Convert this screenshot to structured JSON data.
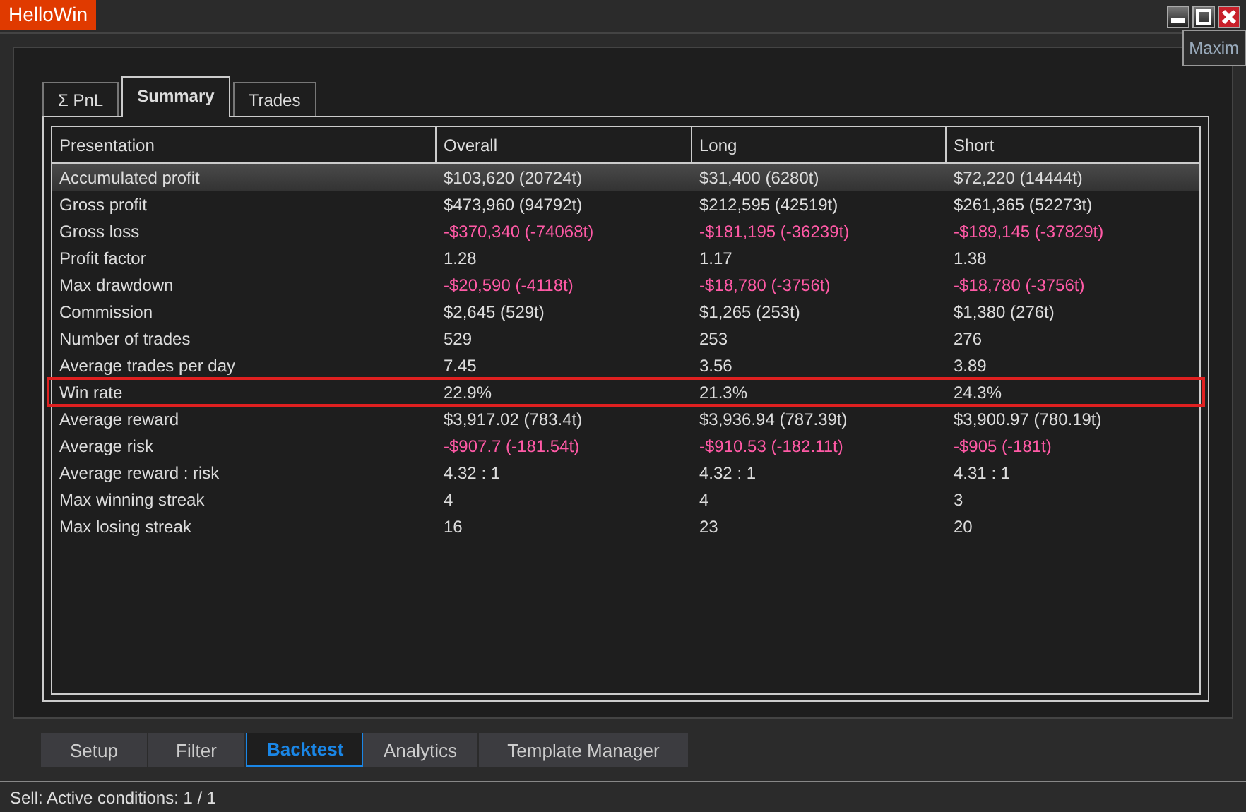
{
  "window": {
    "title": "HelloWin",
    "tooltip": "Maxim"
  },
  "tabs": [
    {
      "label": "Σ PnL",
      "selected": false
    },
    {
      "label": "Summary",
      "selected": true
    },
    {
      "label": "Trades",
      "selected": false
    }
  ],
  "table": {
    "row_header": "Presentation",
    "columns": [
      "Overall",
      "Long",
      "Short"
    ],
    "rows": [
      {
        "label": "Accumulated profit",
        "selected": true,
        "highlighted": false,
        "cells": [
          {
            "text": "$103,620 (20724t)",
            "negative": false
          },
          {
            "text": "$31,400 (6280t)",
            "negative": false
          },
          {
            "text": "$72,220 (14444t)",
            "negative": false
          }
        ]
      },
      {
        "label": "Gross profit",
        "selected": false,
        "highlighted": false,
        "cells": [
          {
            "text": "$473,960 (94792t)",
            "negative": false
          },
          {
            "text": "$212,595 (42519t)",
            "negative": false
          },
          {
            "text": "$261,365 (52273t)",
            "negative": false
          }
        ]
      },
      {
        "label": "Gross loss",
        "selected": false,
        "highlighted": false,
        "cells": [
          {
            "text": "-$370,340 (-74068t)",
            "negative": true
          },
          {
            "text": "-$181,195 (-36239t)",
            "negative": true
          },
          {
            "text": "-$189,145 (-37829t)",
            "negative": true
          }
        ]
      },
      {
        "label": "Profit factor",
        "selected": false,
        "highlighted": false,
        "cells": [
          {
            "text": "1.28",
            "negative": false
          },
          {
            "text": "1.17",
            "negative": false
          },
          {
            "text": "1.38",
            "negative": false
          }
        ]
      },
      {
        "label": "Max drawdown",
        "selected": false,
        "highlighted": false,
        "cells": [
          {
            "text": "-$20,590 (-4118t)",
            "negative": true
          },
          {
            "text": "-$18,780 (-3756t)",
            "negative": true
          },
          {
            "text": "-$18,780 (-3756t)",
            "negative": true
          }
        ]
      },
      {
        "label": "Commission",
        "selected": false,
        "highlighted": false,
        "cells": [
          {
            "text": "$2,645 (529t)",
            "negative": false
          },
          {
            "text": "$1,265 (253t)",
            "negative": false
          },
          {
            "text": "$1,380 (276t)",
            "negative": false
          }
        ]
      },
      {
        "label": "Number of trades",
        "selected": false,
        "highlighted": false,
        "cells": [
          {
            "text": "529",
            "negative": false
          },
          {
            "text": "253",
            "negative": false
          },
          {
            "text": "276",
            "negative": false
          }
        ]
      },
      {
        "label": "Average trades per day",
        "selected": false,
        "highlighted": false,
        "cells": [
          {
            "text": "7.45",
            "negative": false
          },
          {
            "text": "3.56",
            "negative": false
          },
          {
            "text": "3.89",
            "negative": false
          }
        ]
      },
      {
        "label": "Win rate",
        "selected": false,
        "highlighted": true,
        "cells": [
          {
            "text": "22.9%",
            "negative": false
          },
          {
            "text": "21.3%",
            "negative": false
          },
          {
            "text": "24.3%",
            "negative": false
          }
        ]
      },
      {
        "label": "Average reward",
        "selected": false,
        "highlighted": false,
        "cells": [
          {
            "text": "$3,917.02 (783.4t)",
            "negative": false
          },
          {
            "text": "$3,936.94 (787.39t)",
            "negative": false
          },
          {
            "text": "$3,900.97 (780.19t)",
            "negative": false
          }
        ]
      },
      {
        "label": "Average risk",
        "selected": false,
        "highlighted": false,
        "cells": [
          {
            "text": "-$907.7 (-181.54t)",
            "negative": true
          },
          {
            "text": "-$910.53 (-182.11t)",
            "negative": true
          },
          {
            "text": "-$905 (-181t)",
            "negative": true
          }
        ]
      },
      {
        "label": "Average reward : risk",
        "selected": false,
        "highlighted": false,
        "cells": [
          {
            "text": "4.32 : 1",
            "negative": false
          },
          {
            "text": "4.32 : 1",
            "negative": false
          },
          {
            "text": "4.31 : 1",
            "negative": false
          }
        ]
      },
      {
        "label": "Max winning streak",
        "selected": false,
        "highlighted": false,
        "cells": [
          {
            "text": "4",
            "negative": false
          },
          {
            "text": "4",
            "negative": false
          },
          {
            "text": "3",
            "negative": false
          }
        ]
      },
      {
        "label": "Max losing streak",
        "selected": false,
        "highlighted": false,
        "cells": [
          {
            "text": "16",
            "negative": false
          },
          {
            "text": "23",
            "negative": false
          },
          {
            "text": "20",
            "negative": false
          }
        ]
      }
    ]
  },
  "bottom_tabs": [
    {
      "label": "Setup",
      "selected": false
    },
    {
      "label": "Filter",
      "selected": false
    },
    {
      "label": "Backtest",
      "selected": true
    },
    {
      "label": "Analytics",
      "selected": false
    },
    {
      "label": "Template Manager",
      "selected": false
    }
  ],
  "status_bar": "Sell: Active conditions: 1 / 1"
}
